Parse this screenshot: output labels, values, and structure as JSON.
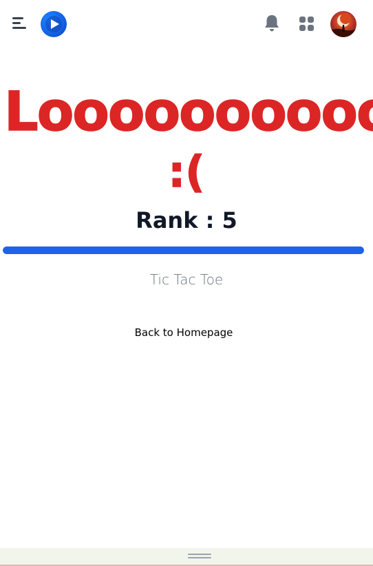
{
  "header": {
    "menu_icon": "menu-icon",
    "logo_icon": "play-logo-icon",
    "notification_icon": "bell-icon",
    "apps_icon": "grid-icon",
    "avatar": "user-avatar"
  },
  "result": {
    "title": "Looooooooooose",
    "frown": ":(",
    "rank_text": "Rank : 5",
    "progress_percent": 100,
    "game_name": "Tic Tac Toe",
    "back_link": "Back to Homepage"
  },
  "colors": {
    "accent_red": "#dc2626",
    "progress_blue": "#1d63ea",
    "text_dark": "#111827",
    "text_muted": "#6b7280"
  }
}
